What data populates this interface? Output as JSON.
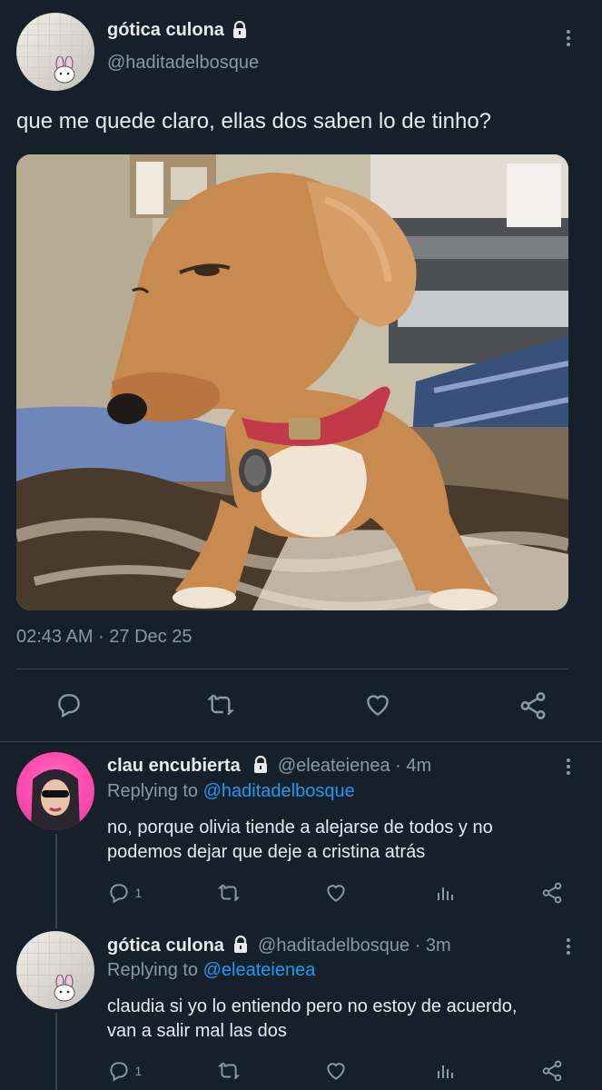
{
  "tweet": {
    "author_name": "gótica culona",
    "handle": "@haditadelbosque",
    "text": "que me quede claro, ellas dos saben lo de tinho?",
    "timestamp": "02:43 AM · 27 Dec 25"
  },
  "replies": [
    {
      "author_name": "clau encubierta",
      "handle": "@eleateienea",
      "time": "· 4m",
      "replying_prefix": "Replying to",
      "replying_to": "@haditadelbosque",
      "text_line1": "no, porque olivia tiende a alejarse de todos y no",
      "text_line2": "podemos dejar que deje a cristina atrás",
      "reply_count": "1"
    },
    {
      "author_name": "gótica culona",
      "handle": "@haditadelbosque",
      "time": "· 3m",
      "replying_prefix": "Replying to",
      "replying_to": "@eleateienea",
      "text_line1": "claudia si yo lo entiendo pero no estoy de acuerdo,",
      "text_line2": "van a salir mal las dos",
      "reply_count": "1"
    }
  ],
  "colors": {
    "background": "#15202b",
    "accent": "#1d9bf0",
    "muted": "#8b98a5",
    "divider": "#38444d"
  }
}
